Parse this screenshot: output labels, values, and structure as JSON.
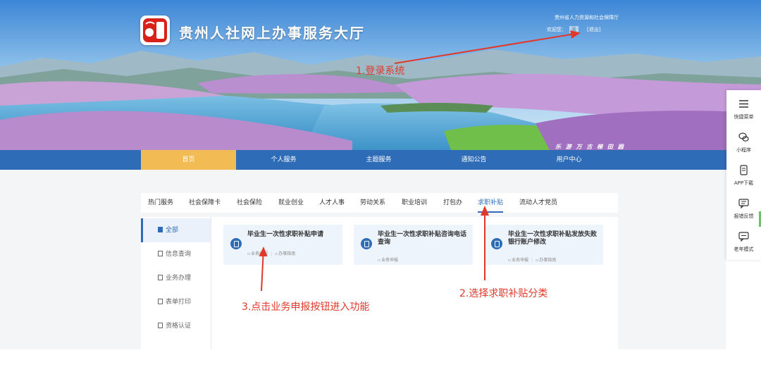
{
  "header": {
    "site_title": "贵州人社网上办事服务大厅",
    "org_name": "贵州省人力资源和社会保障厅",
    "welcome_label": "欢迎您：",
    "user_name": "黄",
    "logout_label": "[退出]",
    "logo_text": "贵州",
    "banner_stamp": "乐 游 万 古 梯 田 园"
  },
  "nav": {
    "items": [
      {
        "label": "首页"
      },
      {
        "label": "个人服务"
      },
      {
        "label": "主题服务"
      },
      {
        "label": "通知公告"
      },
      {
        "label": "用户中心"
      }
    ]
  },
  "category_tabs": [
    {
      "label": "热门服务"
    },
    {
      "label": "社会保障卡"
    },
    {
      "label": "社会保险"
    },
    {
      "label": "就业创业"
    },
    {
      "label": "人才人事"
    },
    {
      "label": "劳动关系"
    },
    {
      "label": "职业培训"
    },
    {
      "label": "打包办"
    },
    {
      "label": "求职补贴"
    },
    {
      "label": "流动人才党员"
    }
  ],
  "sidebar": {
    "items": [
      {
        "label": "全部"
      },
      {
        "label": "信息查询"
      },
      {
        "label": "业务办理"
      },
      {
        "label": "表单打印"
      },
      {
        "label": "资格认证"
      }
    ]
  },
  "cards": [
    {
      "title": "毕业生一次性求职补贴申请",
      "apply_label": "业务申报",
      "guide_label": "办事指南"
    },
    {
      "title": "毕业生一次性求职补贴咨询电话查询",
      "apply_label": "业务申报"
    },
    {
      "title": "毕业生一次性求职补贴发放失败银行账户修改",
      "apply_label": "业务申报",
      "guide_label": "办事指南"
    }
  ],
  "float_bar": {
    "items": [
      {
        "label": "快捷菜单"
      },
      {
        "label": "小程序"
      },
      {
        "label": "APP下载"
      },
      {
        "label": "报错反馈"
      },
      {
        "label": "老年模式"
      }
    ]
  },
  "annotations": {
    "step1": "1.登录系统",
    "step2": "2.选择求职补贴分类",
    "step3": "3.点击业务申报按钮进入功能"
  },
  "colors": {
    "nav_bg": "#2f6cb7",
    "nav_active": "#f2bb53",
    "annotation_red": "#e0392b",
    "accent_blue": "#2f6cb7"
  }
}
